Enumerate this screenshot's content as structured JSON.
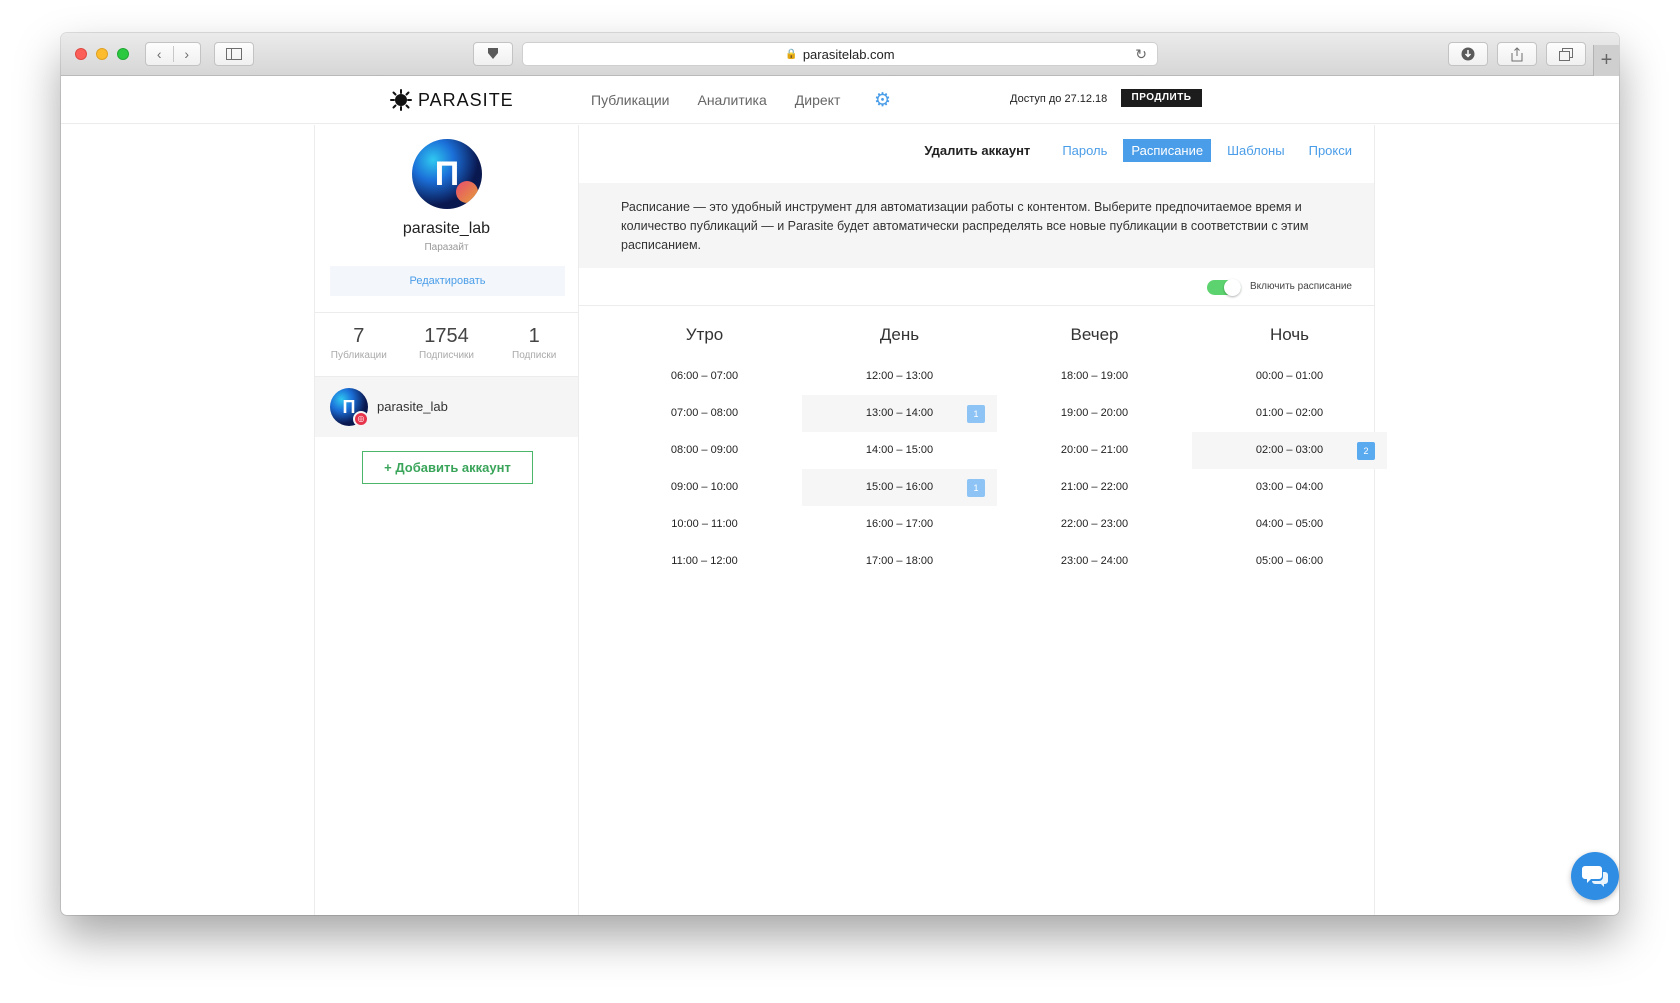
{
  "browser": {
    "url": "parasitelab.com"
  },
  "header": {
    "logo_text": "PARASITE",
    "nav": [
      "Публикации",
      "Аналитика",
      "Директ"
    ],
    "access_text": "Доступ до 27.12.18",
    "renew_label": "ПРОДЛИТЬ"
  },
  "profile": {
    "avatar_letter": "П",
    "name": "parasite_lab",
    "subtitle": "Паразайт",
    "edit_label": "Редактировать",
    "stats": [
      {
        "value": "7",
        "label": "Публикации"
      },
      {
        "value": "1754",
        "label": "Подписчики"
      },
      {
        "value": "1",
        "label": "Подписки"
      }
    ],
    "account_name": "parasite_lab",
    "add_account_label": "+ Добавить аккаунт"
  },
  "panel": {
    "delete_label": "Удалить аккаунт",
    "tabs": [
      "Пароль",
      "Расписание",
      "Шаблоны",
      "Прокси"
    ],
    "active_tab": "Расписание",
    "info_text": "Расписание — это удобный инструмент для автоматизации работы с контентом. Выберите предпочитаемое время и количество публикаций — и Parasite будет автоматически распределять все новые публикации в соответствии с этим расписанием.",
    "toggle_label": "Включить расписание",
    "toggle_on": true
  },
  "schedule": {
    "columns": [
      {
        "title": "Утро",
        "slots": [
          {
            "time": "06:00 – 07:00",
            "count": ""
          },
          {
            "time": "07:00 – 08:00",
            "count": ""
          },
          {
            "time": "08:00 – 09:00",
            "count": ""
          },
          {
            "time": "09:00 – 10:00",
            "count": ""
          },
          {
            "time": "10:00 – 11:00",
            "count": ""
          },
          {
            "time": "11:00 – 12:00",
            "count": ""
          }
        ]
      },
      {
        "title": "День",
        "slots": [
          {
            "time": "12:00 – 13:00",
            "count": ""
          },
          {
            "time": "13:00 – 14:00",
            "count": "1"
          },
          {
            "time": "14:00 – 15:00",
            "count": ""
          },
          {
            "time": "15:00 – 16:00",
            "count": "1"
          },
          {
            "time": "16:00 – 17:00",
            "count": ""
          },
          {
            "time": "17:00 – 18:00",
            "count": ""
          }
        ]
      },
      {
        "title": "Вечер",
        "slots": [
          {
            "time": "18:00 – 19:00",
            "count": ""
          },
          {
            "time": "19:00 – 20:00",
            "count": ""
          },
          {
            "time": "20:00 – 21:00",
            "count": ""
          },
          {
            "time": "21:00 – 22:00",
            "count": ""
          },
          {
            "time": "22:00 – 23:00",
            "count": ""
          },
          {
            "time": "23:00 – 24:00",
            "count": ""
          }
        ]
      },
      {
        "title": "Ночь",
        "slots": [
          {
            "time": "00:00 – 01:00",
            "count": ""
          },
          {
            "time": "01:00 – 02:00",
            "count": ""
          },
          {
            "time": "02:00 – 03:00",
            "count": "2"
          },
          {
            "time": "03:00 – 04:00",
            "count": ""
          },
          {
            "time": "04:00 – 05:00",
            "count": ""
          },
          {
            "time": "05:00 – 06:00",
            "count": ""
          }
        ]
      }
    ]
  },
  "colors": {
    "accent": "#4a9de8",
    "toggle_on": "#5cd36e",
    "add_button": "#4cb66a",
    "chat_button": "#2f8de4"
  },
  "icons": [
    "back-icon",
    "forward-icon",
    "sidebar-icon",
    "pocket-icon",
    "lock-icon",
    "reload-icon",
    "download-icon",
    "share-icon",
    "tabs-icon",
    "new-tab-icon",
    "settings-gear-icon",
    "instagram-icon",
    "chat-icon"
  ]
}
